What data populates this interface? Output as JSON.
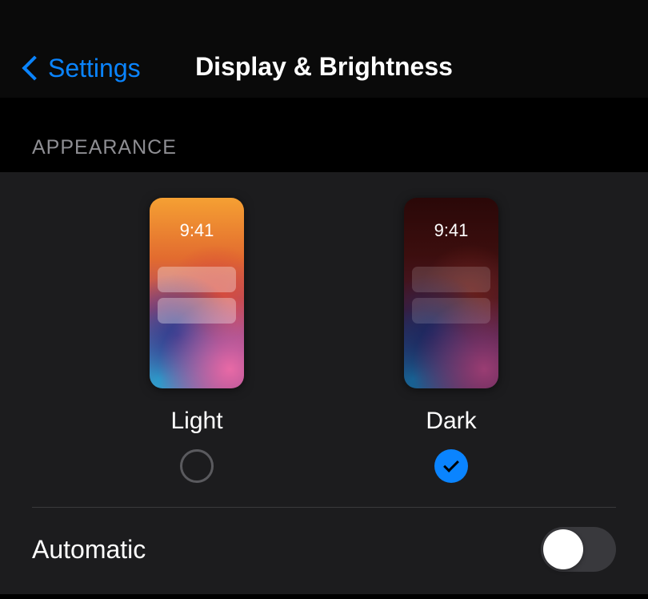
{
  "nav": {
    "back_label": "Settings",
    "title": "Display & Brightness"
  },
  "appearance": {
    "header": "APPEARANCE",
    "options": {
      "light": {
        "label": "Light",
        "time": "9:41",
        "selected": false
      },
      "dark": {
        "label": "Dark",
        "time": "9:41",
        "selected": true
      }
    }
  },
  "automatic": {
    "label": "Automatic",
    "enabled": false
  }
}
